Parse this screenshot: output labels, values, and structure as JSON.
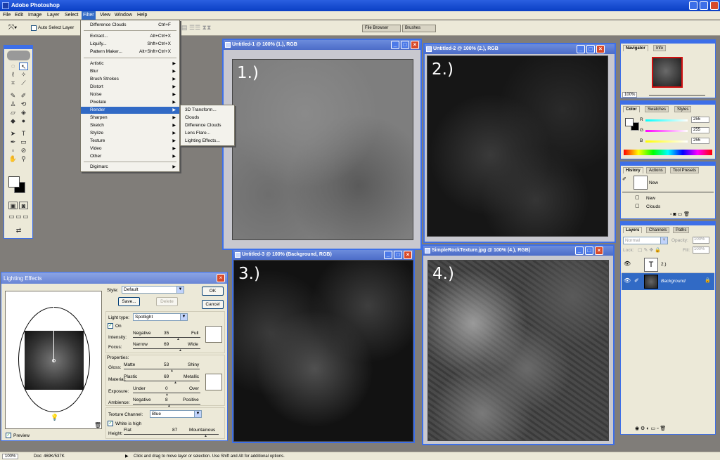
{
  "app": {
    "title": "Adobe Photoshop"
  },
  "menubar": [
    "File",
    "Edit",
    "Image",
    "Layer",
    "Select",
    "Filter",
    "View",
    "Window",
    "Help"
  ],
  "options": {
    "auto_select": "Auto Select Layer",
    "file_browser": "File Browser",
    "brushes": "Brushes"
  },
  "filter_menu": {
    "top": [
      {
        "label": "Difference Clouds",
        "shortcut": "Ctrl+F"
      }
    ],
    "extras": [
      {
        "label": "Extract...",
        "shortcut": "Alt+Ctrl+X"
      },
      {
        "label": "Liquify...",
        "shortcut": "Shft+Ctrl+X"
      },
      {
        "label": "Pattern Maker...",
        "shortcut": "Alt+Shft+Ctrl+X"
      }
    ],
    "groups": [
      "Artistic",
      "Blur",
      "Brush Strokes",
      "Distort",
      "Noise",
      "Pixelate",
      "Render",
      "Sharpen",
      "Sketch",
      "Stylize",
      "Texture",
      "Video",
      "Other"
    ],
    "digimarc": "Digimarc"
  },
  "render_submenu": [
    "3D Transform...",
    "Clouds",
    "Difference Clouds",
    "Lens Flare...",
    "Lighting Effects..."
  ],
  "docs": [
    {
      "title": "Untitled-1 @ 100% (1.), RGB",
      "num": "1.)"
    },
    {
      "title": "Untitled-2 @ 100% (2.), RGB",
      "num": "2.)"
    },
    {
      "title": "Untitled-3 @ 100% (Background, RGB)",
      "num": "3.)"
    },
    {
      "title": "SimpleRockTexture.jpg @ 100% (4.), RGB)",
      "num": "4.)"
    }
  ],
  "navigator": {
    "tabs": [
      "Navigator",
      "Info"
    ],
    "zoom": "100%"
  },
  "color_panel": {
    "tabs": [
      "Color",
      "Swatches",
      "Styles"
    ],
    "channels": [
      {
        "label": "R",
        "value": "255",
        "color": "#00c0c0"
      },
      {
        "label": "G",
        "value": "255",
        "color": "#d000d0"
      },
      {
        "label": "B",
        "value": "255",
        "color": "#e0e000"
      }
    ]
  },
  "history_panel": {
    "tabs": [
      "History",
      "Actions",
      "Tool Presets"
    ],
    "snapshot": "New",
    "items": [
      "New",
      "Clouds"
    ]
  },
  "layers_panel": {
    "tabs": [
      "Layers",
      "Channels",
      "Paths"
    ],
    "blend": "Normal",
    "opacity_label": "Opacity:",
    "opacity": "100%",
    "lock_label": "Lock:",
    "fill_label": "Fill:",
    "fill": "100%",
    "layers": [
      {
        "name": "2.)",
        "type": "T"
      },
      {
        "name": "Background"
      }
    ]
  },
  "lighting": {
    "title": "Lighting Effects",
    "style_label": "Style:",
    "style": "Default",
    "save": "Save...",
    "delete": "Delete",
    "ok": "OK",
    "cancel": "Cancel",
    "light_type_label": "Light type:",
    "light_type": "Spotlight",
    "on": "On",
    "intensity": {
      "label": "Intensity:",
      "min": "Negative",
      "value": "35",
      "max": "Full"
    },
    "focus": {
      "label": "Focus:",
      "min": "Narrow",
      "value": "69",
      "max": "Wide"
    },
    "properties": "Properties:",
    "gloss": {
      "label": "Gloss:",
      "min": "Matte",
      "value": "53",
      "max": "Shiny"
    },
    "material": {
      "label": "Material:",
      "min": "Plastic",
      "value": "69",
      "max": "Metallic"
    },
    "exposure": {
      "label": "Exposure:",
      "min": "Under",
      "value": "0",
      "max": "Over"
    },
    "ambience": {
      "label": "Ambience:",
      "min": "Negative",
      "value": "8",
      "max": "Positive"
    },
    "texture_label": "Texture Channel:",
    "texture": "Blue",
    "white_high": "White is high",
    "height": {
      "label": "Height:",
      "min": "Flat",
      "value": "87",
      "max": "Mountainous"
    },
    "preview": "Preview"
  },
  "status": {
    "zoom": "100%",
    "doc": "Doc: 469K/537K",
    "hint": "Click and drag to move layer or selection. Use Shift and Alt for additional options."
  }
}
